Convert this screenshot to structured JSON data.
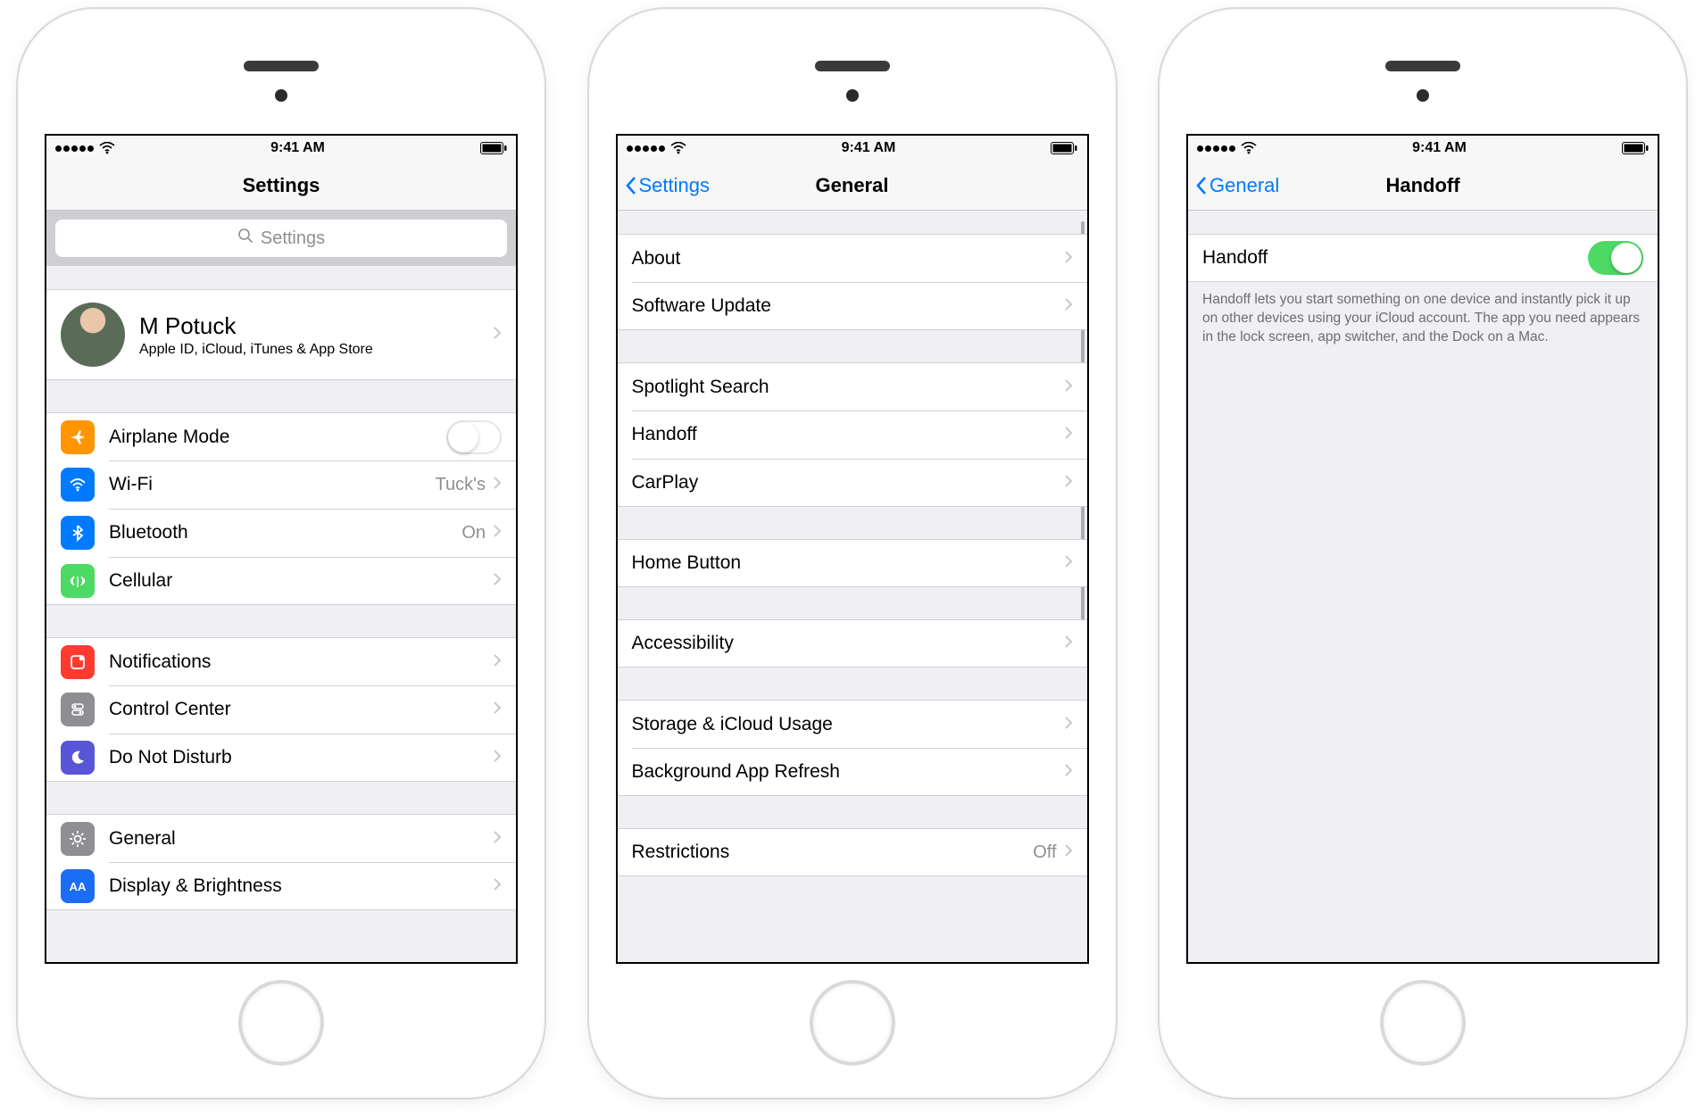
{
  "status": {
    "time": "9:41 AM"
  },
  "screen1": {
    "title": "Settings",
    "search_placeholder": "Settings",
    "profile": {
      "name": "M Potuck",
      "subtitle": "Apple ID, iCloud, iTunes & App Store"
    },
    "group1": {
      "airplane": "Airplane Mode",
      "wifi_label": "Wi-Fi",
      "wifi_value": "Tuck's",
      "bt_label": "Bluetooth",
      "bt_value": "On",
      "cellular": "Cellular"
    },
    "group2": {
      "notifications": "Notifications",
      "control_center": "Control Center",
      "dnd": "Do Not Disturb"
    },
    "group3": {
      "general": "General",
      "display": "Display & Brightness"
    }
  },
  "screen2": {
    "back": "Settings",
    "title": "General",
    "g1": {
      "about": "About",
      "sw": "Software Update"
    },
    "g2": {
      "spotlight": "Spotlight Search",
      "handoff": "Handoff",
      "carplay": "CarPlay"
    },
    "g3": {
      "home": "Home Button"
    },
    "g4": {
      "acc": "Accessibility"
    },
    "g5": {
      "storage": "Storage & iCloud Usage",
      "bgrefresh": "Background App Refresh"
    },
    "g6": {
      "restrictions_label": "Restrictions",
      "restrictions_value": "Off"
    }
  },
  "screen3": {
    "back": "General",
    "title": "Handoff",
    "row": "Handoff",
    "note": "Handoff lets you start something on one device and instantly pick it up on other devices using your iCloud account. The app you need appears in the lock screen, app switcher, and the Dock on a Mac."
  }
}
